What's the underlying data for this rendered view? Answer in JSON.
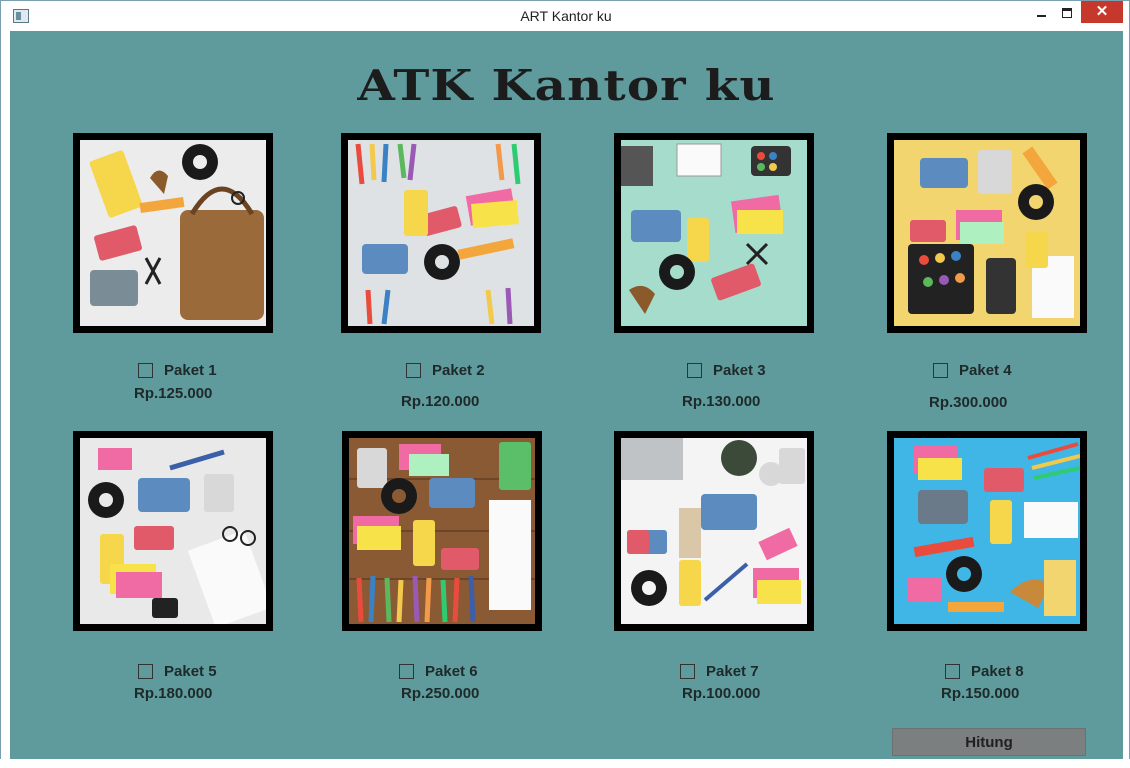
{
  "window": {
    "title": "ART Kantor ku",
    "close_glyph": "✕"
  },
  "heading": "ATK Kantor ku",
  "packages": [
    {
      "label": "Paket 1",
      "price": "Rp.125.000",
      "image": "office-supplies-flatlay"
    },
    {
      "label": "Paket 2",
      "price": "Rp.120.000",
      "image": "office-supplies-flatlay"
    },
    {
      "label": "Paket 3",
      "price": "Rp.130.000",
      "image": "office-supplies-flatlay"
    },
    {
      "label": "Paket 4",
      "price": "Rp.300.000",
      "image": "office-supplies-flatlay"
    },
    {
      "label": "Paket 5",
      "price": "Rp.180.000",
      "image": "office-supplies-flatlay"
    },
    {
      "label": "Paket 6",
      "price": "Rp.250.000",
      "image": "office-supplies-flatlay"
    },
    {
      "label": "Paket 7",
      "price": "Rp.100.000",
      "image": "office-supplies-flatlay"
    },
    {
      "label": "Paket 8",
      "price": "Rp.150.000",
      "image": "office-supplies-flatlay"
    }
  ],
  "button": {
    "label": "Hitung"
  },
  "colors": {
    "background": "#5f9a9c",
    "button": "#7b7f80",
    "close": "#c7382c"
  },
  "icons": [
    "app-icon",
    "minimize-icon",
    "maximize-icon",
    "close-icon"
  ]
}
